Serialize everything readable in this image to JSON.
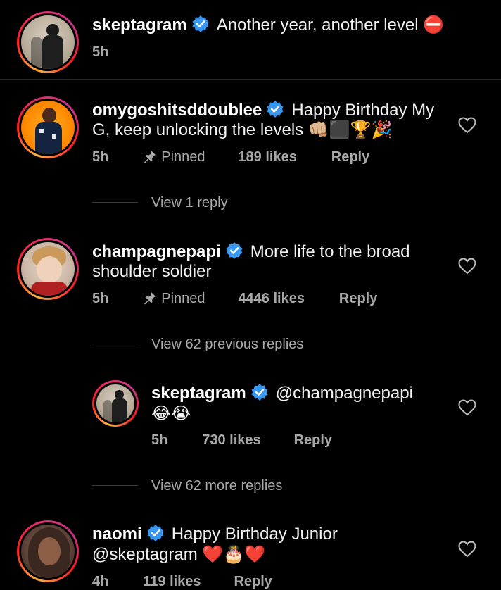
{
  "post": {
    "username": "skeptagram",
    "caption": "Another year, another level ⛔",
    "time": "5h"
  },
  "comments": [
    {
      "username": "omygoshitsddoublee",
      "text_line1": "Happy Birthday My",
      "text_line2": "G, keep unlocking the levels 👊🏼⬛🏆🎉",
      "time": "5h",
      "pinned": "Pinned",
      "likes": "189 likes",
      "reply": "Reply",
      "view_replies": "View 1 reply"
    },
    {
      "username": "champagnepapi",
      "text_line1": "More life to the broad",
      "text_line2": "shoulder soldier",
      "time": "5h",
      "pinned": "Pinned",
      "likes": "4446 likes",
      "reply": "Reply",
      "view_previous": "View 62 previous replies",
      "reply_item": {
        "username": "skeptagram",
        "text_line1": "@champagnepapi",
        "text_line2": "😂😭",
        "time": "5h",
        "likes": "730 likes",
        "reply": "Reply"
      },
      "view_more": "View 62 more replies"
    },
    {
      "username": "naomi",
      "text_line1": "Happy Birthday Junior",
      "text_line2": "@skeptagram ❤️🎂❤️",
      "time": "4h",
      "likes": "119 likes",
      "reply": "Reply"
    }
  ],
  "colors": {
    "background": "#000000",
    "verified": "#3897f0",
    "muted": "#a8a8a8"
  },
  "icons": [
    "verified-badge-icon",
    "pin-icon",
    "heart-icon"
  ]
}
